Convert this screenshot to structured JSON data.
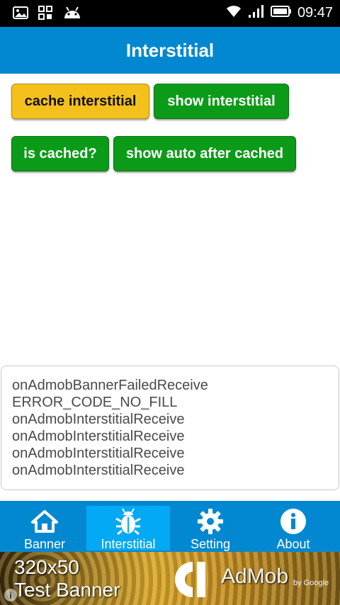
{
  "status_bar": {
    "time": "09:47",
    "icons": [
      "image-icon",
      "apps-grid-icon",
      "android-icon",
      "wifi-icon",
      "signal-icon",
      "battery-icon"
    ]
  },
  "app_bar": {
    "title": "Interstitial"
  },
  "buttons": {
    "cache_interstitial": "cache interstitial",
    "show_interstitial": "show interstitial",
    "is_cached": "is cached?",
    "show_auto_after_cached": "show auto after cached"
  },
  "log": {
    "lines": [
      "onAdmobBannerFailedReceive",
      "ERROR_CODE_NO_FILL",
      "onAdmobInterstitialReceive",
      "onAdmobInterstitialReceive",
      "onAdmobInterstitialReceive",
      "onAdmobInterstitialReceive"
    ]
  },
  "bottom_nav": {
    "items": [
      {
        "label": "Banner",
        "icon": "home-icon"
      },
      {
        "label": "Interstitial",
        "icon": "bug-icon",
        "active": true
      },
      {
        "label": "Setting",
        "icon": "gear-icon"
      },
      {
        "label": "About",
        "icon": "info-icon"
      }
    ]
  },
  "ad_banner": {
    "line1": "320x50",
    "line2": "Test Banner",
    "brand": "AdMob",
    "by": "by Google"
  },
  "colors": {
    "primary": "#0288d1",
    "nav_active": "#03a9f4",
    "button_green": "#0c9b18",
    "button_yellow": "#f4c01c"
  }
}
